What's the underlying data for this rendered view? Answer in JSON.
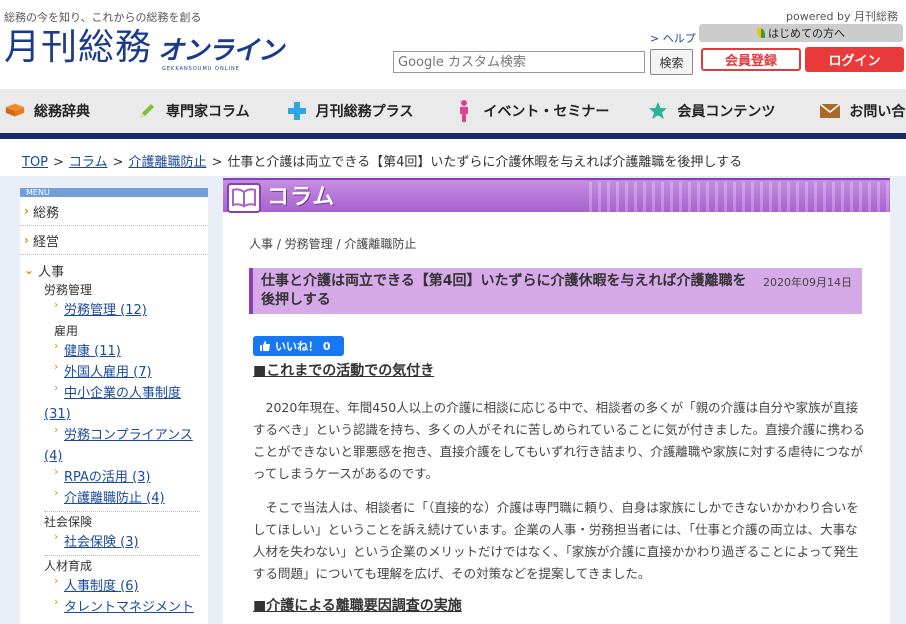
{
  "header": {
    "tagline": "総務の今を知り、これからの総務を創る",
    "logo_kanji": "月刊総務",
    "logo_kana": "オンライン",
    "logo_sub": "GEKKANSOUMU ONLINE",
    "powered_by": "powered by 月刊総務",
    "help_link": "> ヘルプ",
    "first_time": "はじめての方へ",
    "search_placeholder": "Google カスタム検索",
    "search_button": "検索",
    "register_button": "会員登録",
    "login_button": "ログイン"
  },
  "nav": [
    {
      "label": "総務辞典",
      "icon": "book-icon"
    },
    {
      "label": "専門家コラム",
      "icon": "pencil-icon"
    },
    {
      "label": "月刊総務プラス",
      "icon": "plus-icon"
    },
    {
      "label": "イベント・セミナー",
      "icon": "person-icon"
    },
    {
      "label": "会員コンテンツ",
      "icon": "star-icon"
    },
    {
      "label": "お問い合わせ",
      "icon": "mail-icon"
    }
  ],
  "breadcrumb": {
    "top": "TOP",
    "column": "コラム",
    "category": "介護離職防止",
    "current": "仕事と介護は両立できる【第4回】いたずらに介護休暇を与えれば介護離職を後押しする"
  },
  "sidebar": {
    "menu_label": "MENU",
    "cat1": "総務",
    "cat2": "経営",
    "cat3": "人事",
    "sub_labor": "労務管理",
    "leaf_labor": "労務管理 (12)",
    "sub_employ": "雇用",
    "leaf_health": "健康 (11)",
    "leaf_foreign": "外国人雇用 (7)",
    "leaf_sme": "中小企業の人事制度",
    "leaf_sme_count": "(31)",
    "leaf_compliance": "労務コンプライアンス",
    "leaf_compliance_count": "(4)",
    "leaf_rpa": "RPAの活用 (3)",
    "leaf_care": "介護離職防止 (4)",
    "sub_social": "社会保険",
    "leaf_social": "社会保険 (3)",
    "sub_talent": "人材育成",
    "leaf_hr_system": "人事制度 (6)",
    "leaf_talent_mgmt": "タレントマネジメント"
  },
  "content": {
    "banner_title": "コラム",
    "tags": "人事 / 労務管理 / 介護離職防止",
    "article_title": "仕事と介護は両立できる【第4回】いたずらに介護休暇を与えれば介護離職を後押しする",
    "article_date": "2020年09月14日",
    "like_label": "いいね！ 0",
    "h_first": "■これまでの活動での気付き",
    "para1": "2020年現在、年間450人以上の介護に相談に応じる中で、相談者の多くが「親の介護は自分や家族が直接するべき」という認識を持ち、多くの人がそれに苦しめられていることに気が付きました。直接介護に携わることができないと罪悪感を抱き、直接介護をしてもいずれ行き詰まり、介護離職や家族に対する虐待につながってしまうケースがあるのです。",
    "para2": "そこで当法人は、相談者に「（直接的な）介護は専門職に頼り、自身は家族にしかできないかかわり合いをしてほしい」ということを訴え続けています。企業の人事・労務担当者には、「仕事と介護の両立は、大事な人材を失わない」という企業のメリットだけではなく、「家族が介護に直接かかわり過ぎることによって発生する問題」についても理解を広げ、その対策などを提案してきました。",
    "h_second": "■介護による離職要因調査の実施"
  },
  "colors": {
    "brand_navy": "#1a3a8a",
    "accent_red": "#e83a3a",
    "column_purple": "#a861d0",
    "title_bg": "#d6a9e8"
  }
}
